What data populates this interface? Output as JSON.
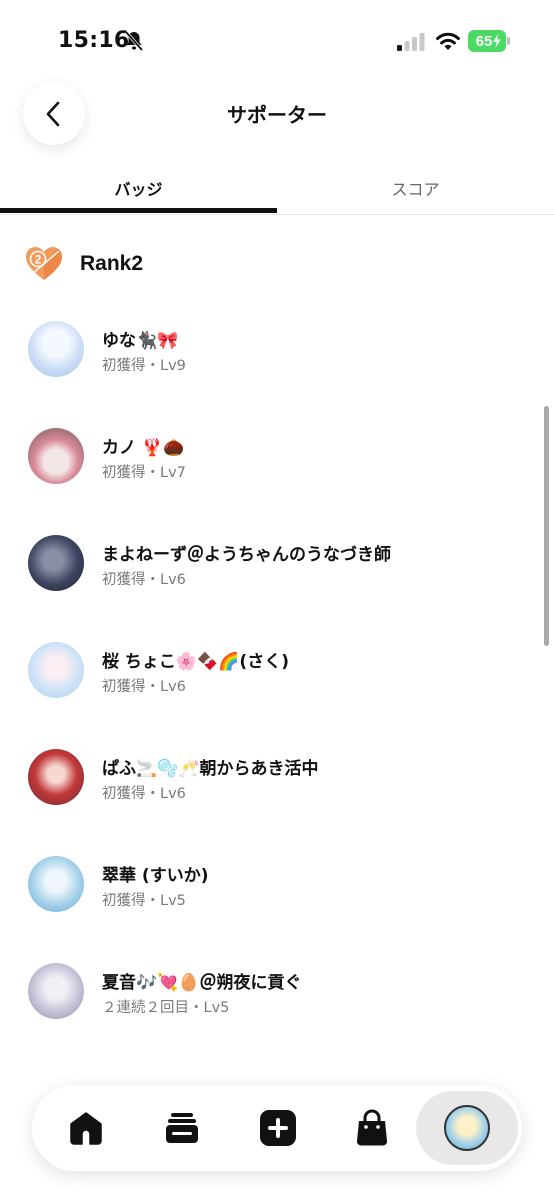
{
  "status_bar": {
    "time": "15:16",
    "battery": "65",
    "icons": [
      "bell-slash-icon",
      "cellular-signal-icon",
      "wifi-icon",
      "battery-charging-icon"
    ]
  },
  "header": {
    "title": "サポーター",
    "back_icon": "chevron-left-icon"
  },
  "tabs": [
    {
      "label": "バッジ",
      "active": true
    },
    {
      "label": "スコア",
      "active": false
    }
  ],
  "rank": {
    "label": "Rank2",
    "badge_number": "2",
    "icon": "heart-rank-badge-icon",
    "color": "#f08c4a"
  },
  "supporters": [
    {
      "name": "ゆな🐈‍⬛🎀",
      "status": "初獲得・Lv9"
    },
    {
      "name": "カノ 🦞🌰",
      "status": "初獲得・Lv7"
    },
    {
      "name": "まよねーず＠ようちゃんのうなづき師",
      "status": "初獲得・Lv6"
    },
    {
      "name": "桜 ちょこ🌸🍫🌈(さく)",
      "status": "初獲得・Lv6"
    },
    {
      "name": "ぱふ🚬🫧🥂朝からあき活中",
      "status": "初獲得・Lv6"
    },
    {
      "name": "翠華 (すいか)",
      "status": "初獲得・Lv5"
    },
    {
      "name": "夏音🎶💘🥚＠朔夜に貢ぐ",
      "status": "２連続２回目・Lv5"
    }
  ],
  "bottom_nav": [
    {
      "name": "home",
      "icon": "home-icon"
    },
    {
      "name": "timeline",
      "icon": "stack-icon"
    },
    {
      "name": "add",
      "icon": "plus-square-icon"
    },
    {
      "name": "shop",
      "icon": "shopping-bag-icon"
    },
    {
      "name": "profile",
      "icon": "profile-avatar-icon"
    }
  ],
  "colors": {
    "accent": "#111111",
    "subtext": "#7a7a7a",
    "battery": "#4cd964",
    "rank_badge": "#f08c4a"
  }
}
